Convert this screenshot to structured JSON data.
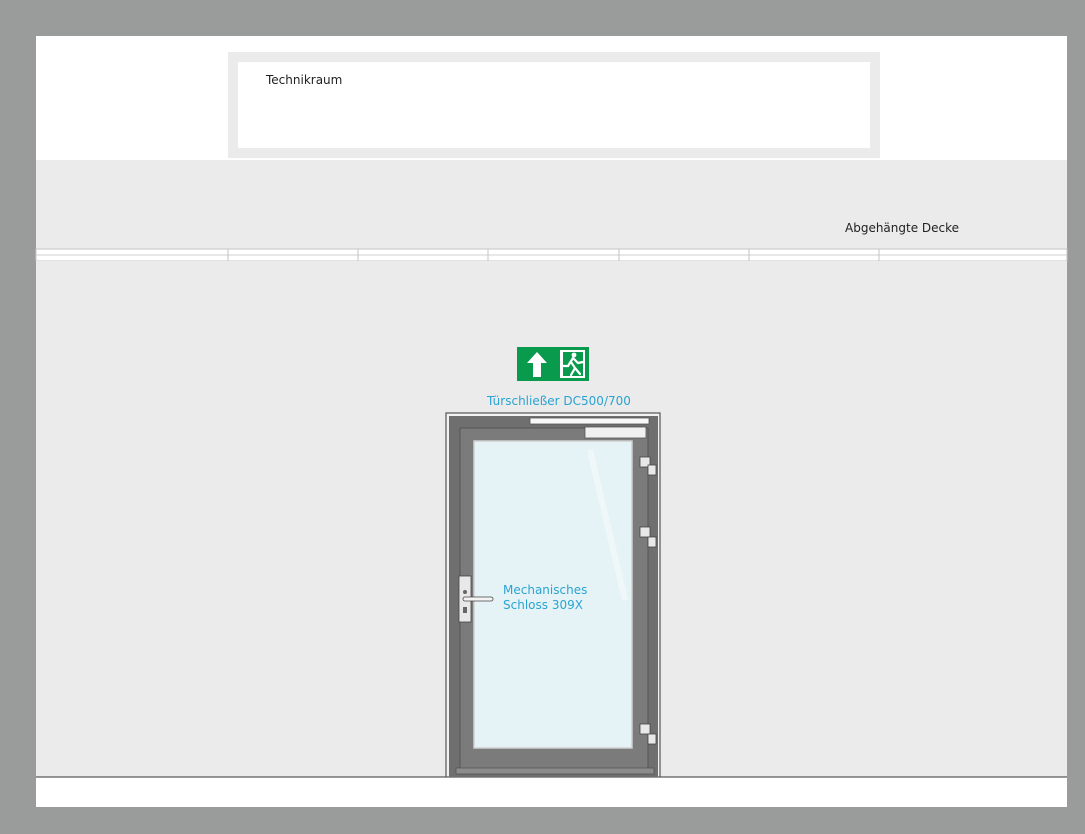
{
  "room_label": "Technikraum",
  "ceiling_label": "Abgehängte Decke",
  "door_closer_label": "Türschließer DC500/700",
  "lock_label_line1": "Mechanisches",
  "lock_label_line2": "Schloss 309X",
  "icons": {
    "exit_sign": "emergency-exit-sign",
    "exit_arrow": "arrow-up",
    "exit_person": "running-person"
  },
  "colors": {
    "frame_gray": "#9a9b9b",
    "wall": "#ececec",
    "white": "#ffffff",
    "door_frame": "#707070",
    "glass": "#e4f2f4",
    "label_blue": "#2aa3d2",
    "exit_green": "#0a9a4e"
  }
}
